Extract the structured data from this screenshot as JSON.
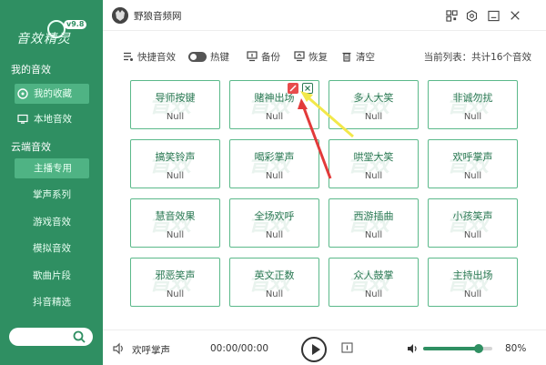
{
  "app": {
    "logo_text": "音效精灵",
    "version": "v9.8",
    "title": "野狼音频网"
  },
  "sidebar": {
    "section_mine": "我的音效",
    "mine_items": [
      {
        "label": "我的收藏",
        "icon": "chat-bubble-icon",
        "active": true
      },
      {
        "label": "本地音效",
        "icon": "monitor-icon",
        "active": false
      }
    ],
    "section_cloud": "云端音效",
    "cloud_items": [
      {
        "label": "主播专用",
        "active": true
      },
      {
        "label": "掌声系列",
        "active": false
      },
      {
        "label": "游戏音效",
        "active": false
      },
      {
        "label": "模拟音效",
        "active": false
      },
      {
        "label": "歌曲片段",
        "active": false
      },
      {
        "label": "抖音精选",
        "active": false
      }
    ]
  },
  "toolbar": {
    "quick_label": "快捷音效",
    "hotkey_label": "热键",
    "backup_label": "备份",
    "restore_label": "恢复",
    "clear_label": "清空",
    "list_status": "当前列表：共计16个音效"
  },
  "grid": {
    "watermark": "音效",
    "cards": [
      {
        "name": "导师按键",
        "value": "Null"
      },
      {
        "name": "赌神出场",
        "value": "Null"
      },
      {
        "name": "多人大笑",
        "value": "Null"
      },
      {
        "name": "非诚勿扰",
        "value": "Null"
      },
      {
        "name": "搞笑铃声",
        "value": "Null"
      },
      {
        "name": "喝彩掌声",
        "value": "Null"
      },
      {
        "name": "哄堂大笑",
        "value": "Null"
      },
      {
        "name": "欢呼掌声",
        "value": "Null"
      },
      {
        "name": "慧音效果",
        "value": "Null"
      },
      {
        "name": "全场欢呼",
        "value": "Null"
      },
      {
        "name": "西游插曲",
        "value": "Null"
      },
      {
        "name": "小孩笑声",
        "value": "Null"
      },
      {
        "name": "邪恶笑声",
        "value": "Null"
      },
      {
        "name": "英文正数",
        "value": "Null"
      },
      {
        "name": "众人鼓掌",
        "value": "Null"
      },
      {
        "name": "主持出场",
        "value": "Null"
      }
    ]
  },
  "player": {
    "now_playing": "欢呼掌声",
    "time": "00:00/00:00",
    "volume_text": "80%",
    "volume_level": 0.8
  },
  "colors": {
    "sidebar_bg": "#2f8f62",
    "accent": "#5bb98a",
    "active_item": "#4fb384"
  }
}
